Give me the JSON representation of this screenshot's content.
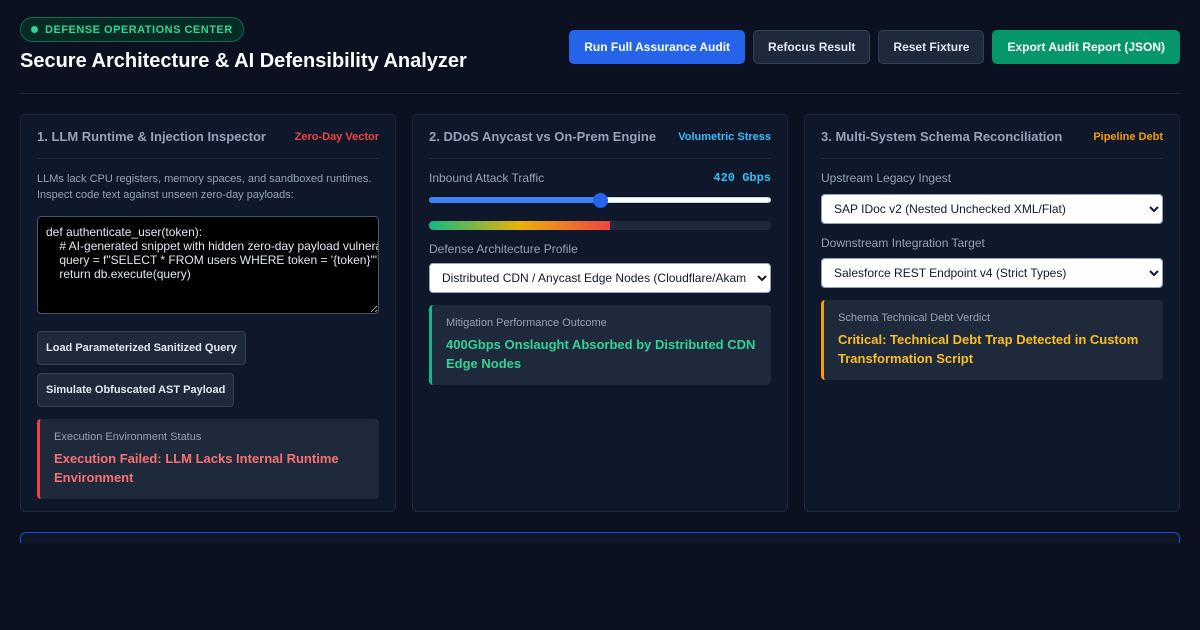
{
  "header": {
    "badge": "DEFENSE OPERATIONS CENTER",
    "title": "Secure Architecture & AI Defensibility Analyzer",
    "actions": {
      "run_audit": "Run Full Assurance Audit",
      "refocus": "Refocus Result",
      "reset": "Reset Fixture",
      "export": "Export Audit Report (JSON)"
    }
  },
  "colors": {
    "accent_blue": "#2563eb",
    "accent_green": "#059669",
    "danger": "#ef4444",
    "info": "#38bdf8",
    "warning": "#f59e0b",
    "success_text": "#34d399"
  },
  "panels": {
    "llm": {
      "title": "1. LLM Runtime & Injection Inspector",
      "tag": "Zero-Day Vector",
      "description": "LLMs lack CPU registers, memory spaces, and sandboxed runtimes. Inspect code text against unseen zero-day payloads:",
      "code": "def authenticate_user(token):\n    # AI-generated snippet with hidden zero-day payload vulnerability\n    query = f\"SELECT * FROM users WHERE token = '{token}'\"\n    return db.execute(query)",
      "load_button": "Load Parameterized Sanitized Query",
      "simulate_button": "Simulate Obfuscated AST Payload",
      "status_label": "Execution Environment Status",
      "status_value": "Execution Failed: LLM Lacks Internal Runtime Environment"
    },
    "ddos": {
      "title": "2. DDoS Anycast vs On-Prem Engine",
      "tag": "Volumetric Stress",
      "traffic_label": "Inbound Attack Traffic",
      "traffic_value": "420 Gbps",
      "traffic_fraction": 0.5,
      "meter_fraction": 0.53,
      "profile_label": "Defense Architecture Profile",
      "profile_selected": "Distributed CDN / Anycast Edge Nodes (Cloudflare/Akamai)",
      "outcome_label": "Mitigation Performance Outcome",
      "outcome_value": "400Gbps Onslaught Absorbed by Distributed CDN Edge Nodes"
    },
    "schema": {
      "title": "3. Multi-System Schema Reconciliation",
      "tag": "Pipeline Debt",
      "upstream_label": "Upstream Legacy Ingest",
      "upstream_selected": "SAP IDoc v2 (Nested Unchecked XML/Flat)",
      "downstream_label": "Downstream Integration Target",
      "downstream_selected": "Salesforce REST Endpoint v4 (Strict Types)",
      "verdict_label": "Schema Technical Debt Verdict",
      "verdict_value": "Critical: Technical Debt Trap Detected in Custom Transformation Script"
    }
  }
}
